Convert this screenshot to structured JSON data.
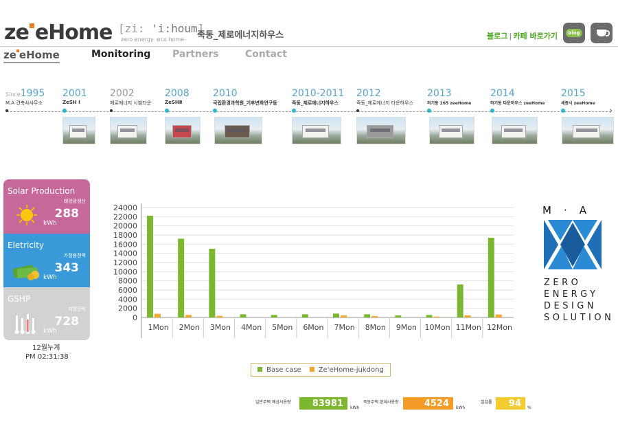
{
  "header": {
    "logo_left": "ze",
    "logo_right": "eHome",
    "phonetic_open": "[zi:",
    "phonetic_mid": "'i:houm",
    "phonetic_close": "]",
    "phonetic_sub_a": "zero energy",
    "phonetic_sub_b": "eco",
    "phonetic_sub_c": "home",
    "brand_korean": "죽동_제로에너지하우스",
    "blog_link": "블로그",
    "cafe_link": "카페 바로가기",
    "blog_icon_label": "blog"
  },
  "nav": {
    "home_left": "ze",
    "home_right": "eHome",
    "items": [
      "Monitoring",
      "Partners",
      "Contact"
    ],
    "active": "Monitoring"
  },
  "timeline": [
    {
      "since": "Since",
      "year": "1995",
      "label": "M.A 건축사사무소"
    },
    {
      "year": "2001",
      "label": "ZeSH I"
    },
    {
      "year": "2002",
      "label": "제로에너지 시범타운"
    },
    {
      "year": "2008",
      "label": "ZeSHⅡ"
    },
    {
      "year": "2010",
      "label": "국립환경과학원_기후변화연구동"
    },
    {
      "year": "2010-2011",
      "label": "죽동_제로에너지하우스"
    },
    {
      "year": "2012",
      "label": "죽동_제로에너지 타운하우스"
    },
    {
      "year": "2013",
      "label": "하기동 265 zeeHome"
    },
    {
      "year": "2014",
      "label": "하기동 타운하우스 zeeHome"
    },
    {
      "year": "2015",
      "label": "세종시 zeeHome"
    }
  ],
  "panels": {
    "solar": {
      "title": "Solar Production",
      "sub": "태양광생산",
      "value": "288",
      "unit": "kWh"
    },
    "electricity": {
      "title": "Eletricity",
      "sub": "가정용전력",
      "value": "343",
      "unit": "kWh"
    },
    "gshp": {
      "title": "GSHP",
      "sub": "지열전력",
      "value": "728",
      "unit": "kWh"
    }
  },
  "summary": {
    "period_label": "12월누계",
    "clock": "PM 02:31:38"
  },
  "chart_data": {
    "type": "bar",
    "categories": [
      "1Mon",
      "2Mon",
      "3Mon",
      "4Mon",
      "5Mon",
      "6Mon",
      "7Mon",
      "8Mon",
      "9Mon",
      "10Mon",
      "11Mon",
      "12Mon"
    ],
    "series": [
      {
        "name": "Base case",
        "color": "#7cb82f",
        "values": [
          22200,
          17200,
          15000,
          700,
          550,
          700,
          850,
          700,
          450,
          550,
          7200,
          17400
        ]
      },
      {
        "name": "Ze'eHome-jukdong",
        "color": "#f0a830",
        "values": [
          800,
          550,
          350,
          0,
          0,
          0,
          450,
          300,
          0,
          200,
          450,
          650
        ]
      }
    ],
    "yticks": [
      0,
      2000,
      4000,
      6000,
      8000,
      10000,
      12000,
      14000,
      16000,
      18000,
      20000,
      22000,
      24000
    ],
    "ylim": [
      0,
      24000
    ],
    "grid": true,
    "legend": "bottom"
  },
  "stats": [
    {
      "label": "일반주택 예상사용량",
      "value": "83981",
      "unit": "kWh",
      "color": "#7cb82f"
    },
    {
      "label": "죽동주택 현재사용량",
      "value": "4524",
      "unit": "kWh",
      "color": "#f39c28"
    },
    {
      "label": "절감률",
      "value": "94",
      "unit": "%",
      "color": "#f2cc30"
    }
  ],
  "ma_logo": {
    "top": "M·A",
    "lines": [
      "ZERO",
      "ENERGY",
      "DESIGN",
      "SOLUTION"
    ]
  }
}
